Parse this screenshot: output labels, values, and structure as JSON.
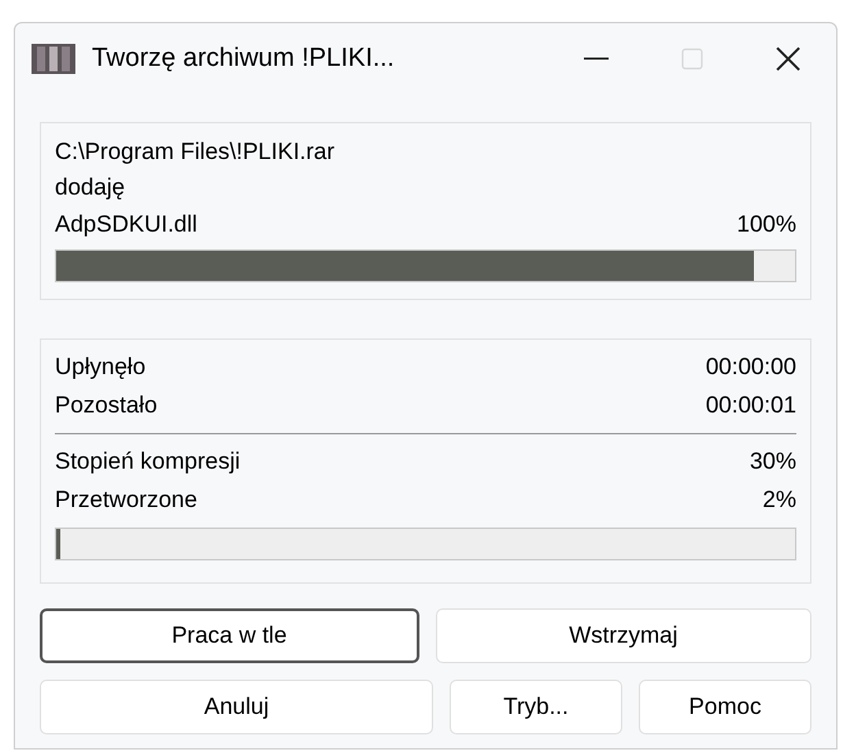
{
  "window": {
    "title": "Tworzę archiwum !PLIKI...",
    "maximize_disabled": true
  },
  "file": {
    "path": "C:\\Program Files\\!PLIKI.rar",
    "action": "dodaję",
    "name": "AdpSDKUI.dll",
    "percent": "100%",
    "level": 0.945
  },
  "times": [
    {
      "label": "Upłynęło",
      "value": "00:00:00"
    },
    {
      "label": "Pozostało",
      "value": "00:00:01"
    }
  ],
  "stats": [
    {
      "label": "Stopień kompresji",
      "value": "30%"
    },
    {
      "label": "Przetworzone",
      "value": "2%"
    }
  ],
  "total_progress": {
    "level": 0.005
  },
  "buttons": [
    [
      {
        "label": "Praca w tle",
        "focused": true
      },
      {
        "label": "Wstrzymaj",
        "focused": false
      }
    ],
    [
      {
        "label": "Anuluj",
        "focused": false
      },
      {
        "label": "Tryb...",
        "focused": false
      },
      {
        "label": "Pomoc",
        "focused": false
      }
    ]
  ]
}
